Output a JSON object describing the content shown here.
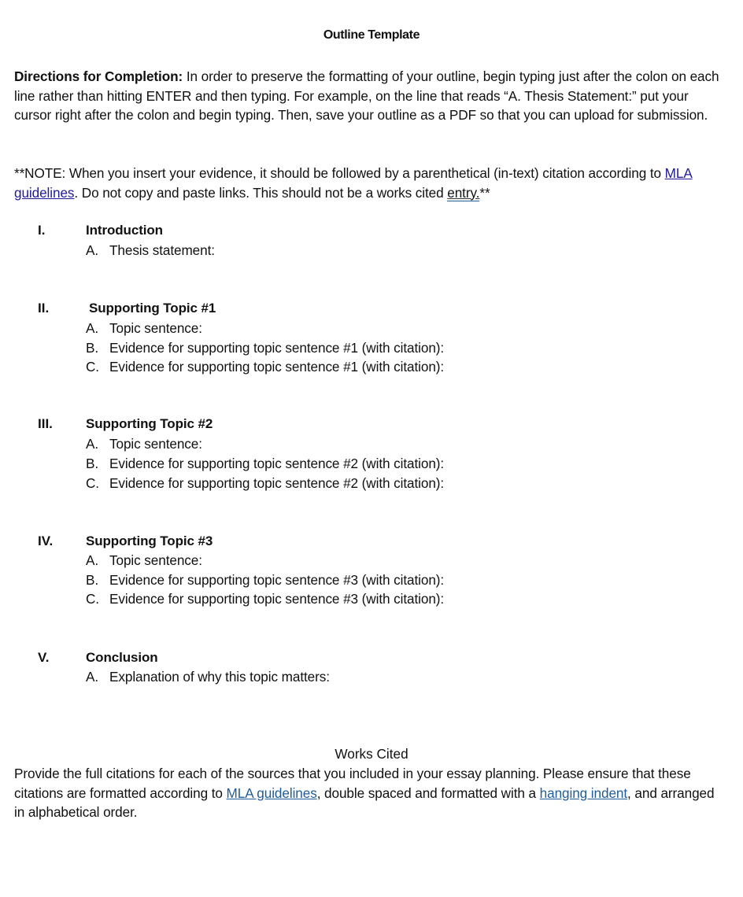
{
  "document": {
    "title": "Outline Template",
    "directions": {
      "label": "Directions for Completion:",
      "text": " In order to preserve the formatting of your outline, begin typing just after the colon on each line rather than hitting ENTER and then typing. For example, on the line that reads “A. Thesis Statement:” put your cursor right after the colon and begin typing. Then, save your outline as a PDF so that you can upload for submission."
    },
    "note": {
      "before_link": "**NOTE: When you insert your evidence, it should be followed by a parenthetical (in-text) citation according to ",
      "link": "MLA guidelines",
      "after_link": ". Do not copy and paste links. This should not be a works cited ",
      "entry": "entry.",
      "end": "**"
    },
    "outline": [
      {
        "numeral": "I.",
        "heading": "Introduction",
        "items": [
          {
            "letter": "A.",
            "text": "Thesis statement:"
          }
        ]
      },
      {
        "numeral": "II.",
        "heading": "Supporting Topic #1",
        "items": [
          {
            "letter": "A.",
            "text": "Topic sentence:"
          },
          {
            "letter": "B.",
            "text": "Evidence for supporting topic sentence #1 (with citation):"
          },
          {
            "letter": "C.",
            "text": "Evidence for supporting topic sentence #1 (with citation):"
          }
        ]
      },
      {
        "numeral": "III.",
        "heading": "Supporting Topic #2",
        "items": [
          {
            "letter": "A.",
            "text": "Topic sentence:"
          },
          {
            "letter": "B.",
            "text": "Evidence for supporting topic sentence #2 (with citation):"
          },
          {
            "letter": "C.",
            "text": "Evidence for supporting topic sentence #2 (with citation):"
          }
        ]
      },
      {
        "numeral": "IV.",
        "heading": "Supporting Topic #3",
        "items": [
          {
            "letter": "A.",
            "text": "Topic sentence:"
          },
          {
            "letter": "B.",
            "text": "Evidence for supporting topic sentence #3 (with citation):"
          },
          {
            "letter": "C.",
            "text": "Evidence for supporting topic sentence #3 (with citation):"
          }
        ]
      },
      {
        "numeral": "V.",
        "heading": "Conclusion",
        "items": [
          {
            "letter": "A.",
            "text": "Explanation of why this topic matters:"
          }
        ]
      }
    ],
    "works_cited": {
      "title": "Works Cited",
      "text1": "Provide the full citations for each of the sources that you included in your essay planning. Please ensure that these citations are formatted according to ",
      "link1": "MLA guidelines",
      "text2": ", double spaced and formatted with a ",
      "link2": "hanging indent",
      "text3": ", and arranged in alphabetical order."
    },
    "colors": {
      "note_link": "#1f1a9e",
      "works_cited_link": "#1f5c99",
      "text": "#111111"
    }
  }
}
